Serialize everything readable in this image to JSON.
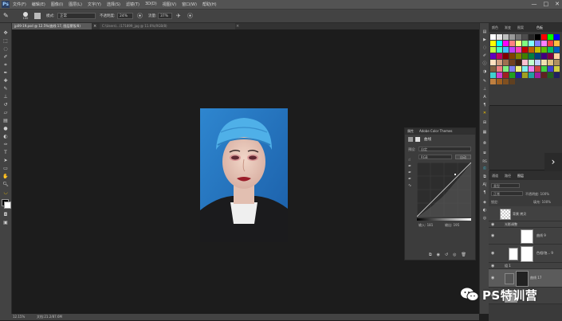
{
  "menubar": {
    "logo": "Ps",
    "items": [
      "文件(F)",
      "编辑(E)",
      "图像(I)",
      "图层(L)",
      "文字(Y)",
      "选择(S)",
      "滤镜(T)",
      "3D(D)",
      "视图(V)",
      "窗口(W)",
      "帮助(H)"
    ],
    "window_controls": [
      "—",
      "□",
      "✕"
    ]
  },
  "options_bar": {
    "brush_size": "100",
    "mode_label": "模式:",
    "mode_value": "正常",
    "opacity_label": "不透明度:",
    "opacity_value": "24%",
    "flow_label": "流量:",
    "flow_value": "37%"
  },
  "tabs": [
    {
      "title": "jp09-19.psd @ 12.5%(曲线 17, 图层蒙版/8)",
      "active": true
    },
    {
      "title": "C:\\Users\\...\\171899_jpg @ 11.6%(RGB/8)",
      "active": false
    }
  ],
  "statusbar": {
    "zoom": "12.15%",
    "doc": "文档:21.2/87.6M"
  },
  "properties": {
    "tab1": "属性",
    "tab2": "Adobe Color Themes",
    "panel_title": "曲线",
    "preset_label": "预设:",
    "preset_value": "自定",
    "channel_value": "RGB",
    "auto_button": "自动",
    "input_label": "输入: 181",
    "output_label": "输出: 195"
  },
  "swatches": {
    "tab1": "颜色",
    "tab2": "色板",
    "tab3": "渐变",
    "tab4": "图案",
    "colors": [
      "#ffffff",
      "#e6e6e6",
      "#bfbfbf",
      "#999999",
      "#737373",
      "#4d4d4d",
      "#262626",
      "#000000",
      "#ff0000",
      "#00ff00",
      "#0000ff",
      "#ffff00",
      "#00ffff",
      "#ff00ff",
      "#ff8080",
      "#ffff80",
      "#80ff80",
      "#80ffff",
      "#8080ff",
      "#ff80ff",
      "#ff4040",
      "#ffbf40",
      "#bfff40",
      "#40ffbf",
      "#40bfff",
      "#bf40ff",
      "#ff40bf",
      "#c00000",
      "#c06000",
      "#c0c000",
      "#60c000",
      "#00c060",
      "#0060c0",
      "#6000c0",
      "#c00060",
      "#800000",
      "#804000",
      "#808000",
      "#408000",
      "#008040",
      "#004080",
      "#400080",
      "#800040",
      "#ffd0a0",
      "#ffe0c0",
      "#d0a080",
      "#a07050",
      "#704020",
      "#402010",
      "#ffc0d0",
      "#c0ffd0",
      "#c0d0ff",
      "#f0e0b0",
      "#e0c080",
      "#b09060",
      "#806040",
      "#f08080",
      "#80f080",
      "#8080f0",
      "#f0f080",
      "#80f0f0",
      "#f080f0",
      "#d04040",
      "#40d040",
      "#4040d0",
      "#d0d040",
      "#40d0d0",
      "#d040d0",
      "#a02020",
      "#20a020",
      "#2020a0",
      "#a0a020",
      "#20a0a0",
      "#a020a0",
      "#602020",
      "#206020",
      "#202060",
      "#c08040",
      "#a06020",
      "#805020",
      "#604020"
    ]
  },
  "layers": {
    "tab1": "图层",
    "tab2": "通道",
    "tab3": "路径",
    "kind_label": "类型",
    "blend_label": "正常",
    "opacity_label": "不透明度: 100%",
    "lock_label": "锁定:",
    "fill_label": "填充: 100%",
    "rows": [
      {
        "name": "背景 拷贝",
        "selected": false
      },
      {
        "name": "光影调整",
        "selected": false
      },
      {
        "name": "曲线 9",
        "selected": false
      },
      {
        "name": "色相/饱... 9",
        "selected": false
      },
      {
        "name": "组 1",
        "selected": false
      },
      {
        "name": "曲线 17",
        "selected": true
      }
    ]
  },
  "watermark": {
    "text": "PS特训营"
  }
}
